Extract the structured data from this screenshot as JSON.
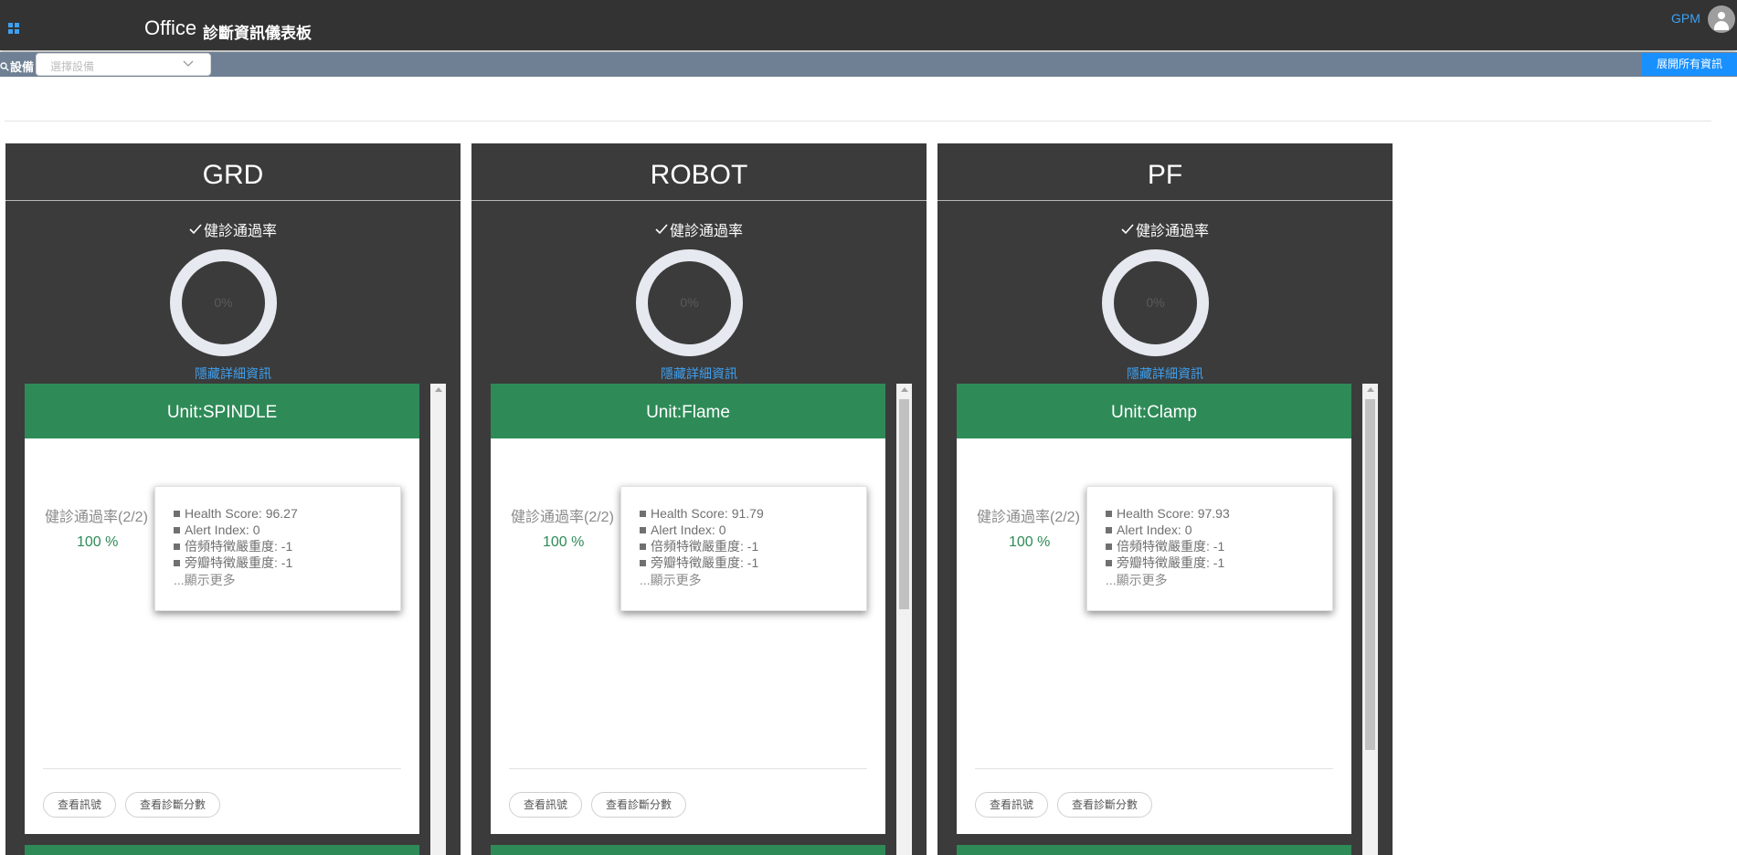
{
  "header": {
    "brand": "Office",
    "title": "診斷資訊儀表板",
    "user": "GPM"
  },
  "filter": {
    "label": "設備",
    "placeholder": "選擇設備",
    "expand_label": "展開所有資訊"
  },
  "colors": {
    "topbar": "#333333",
    "filterbar": "#6f8094",
    "panel": "#3b3b3b",
    "unit_header": "#2e8b57",
    "accent": "#1890ff",
    "link": "#3ea0f0"
  },
  "columns": [
    {
      "title": "GRD",
      "pass_label": "健診通過率",
      "pass_percent": "0%",
      "pass_value": 0,
      "hide_link": "隱藏詳細資訊",
      "scroll_thumb_fraction": 0,
      "unit": {
        "title": "Unit:SPINDLE",
        "rate_label": "健診通過率(2/2)",
        "rate_value": "100 %",
        "metrics": [
          "Health Score: 96.27",
          "Alert Index: 0",
          "倍頻特徵嚴重度: -1",
          "旁瓣特徵嚴重度: -1"
        ],
        "more": "...顯示更多",
        "btn_signal": "查看訊號",
        "btn_score": "查看診斷分數"
      }
    },
    {
      "title": "ROBOT",
      "pass_label": "健診通過率",
      "pass_percent": "0%",
      "pass_value": 0,
      "hide_link": "隱藏詳細資訊",
      "scroll_thumb_fraction": 0.48,
      "unit": {
        "title": "Unit:Flame",
        "rate_label": "健診通過率(2/2)",
        "rate_value": "100 %",
        "metrics": [
          "Health Score: 91.79",
          "Alert Index: 0",
          "倍頻特徵嚴重度: -1",
          "旁瓣特徵嚴重度: -1"
        ],
        "more": "...顯示更多",
        "btn_signal": "查看訊號",
        "btn_score": "查看診斷分數"
      }
    },
    {
      "title": "PF",
      "pass_label": "健診通過率",
      "pass_percent": "0%",
      "pass_value": 0,
      "hide_link": "隱藏詳細資訊",
      "scroll_thumb_fraction": 0.8,
      "unit": {
        "title": "Unit:Clamp",
        "rate_label": "健診通過率(2/2)",
        "rate_value": "100 %",
        "metrics": [
          "Health Score: 97.93",
          "Alert Index: 0",
          "倍頻特徵嚴重度: -1",
          "旁瓣特徵嚴重度: -1"
        ],
        "more": "...顯示更多",
        "btn_signal": "查看訊號",
        "btn_score": "查看診斷分數"
      }
    }
  ]
}
